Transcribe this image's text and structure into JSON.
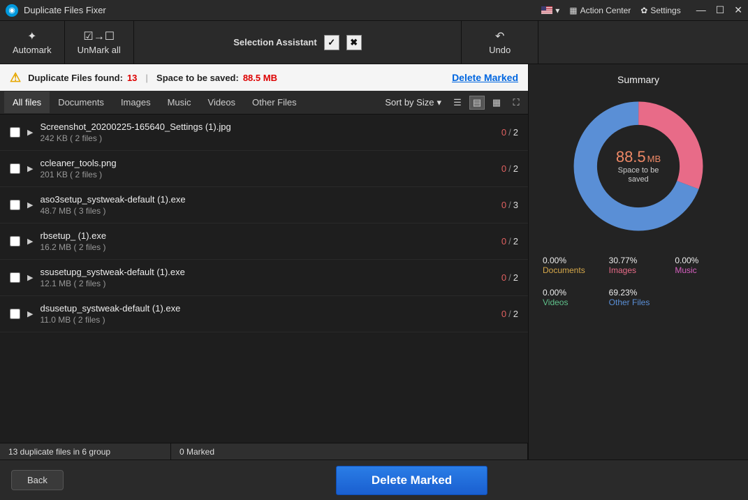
{
  "app": {
    "title": "Duplicate Files Fixer"
  },
  "titlebar": {
    "action_center": "Action Center",
    "settings": "Settings"
  },
  "toolbar": {
    "automark": "Automark",
    "unmark_all": "UnMark all",
    "selection_assistant": "Selection Assistant",
    "undo": "Undo"
  },
  "infobar": {
    "dup_label": "Duplicate Files found:",
    "dup_count": "13",
    "space_label": "Space to be saved:",
    "space_value": "88.5 MB",
    "delete_marked": "Delete Marked"
  },
  "tabs": {
    "all": "All files",
    "documents": "Documents",
    "images": "Images",
    "music": "Music",
    "videos": "Videos",
    "other": "Other Files",
    "sort_label": "Sort by Size"
  },
  "files": [
    {
      "name": "Screenshot_20200225-165640_Settings (1).jpg",
      "size": "242 KB",
      "count_label": "( 2 files )",
      "marked": "0",
      "total": "2"
    },
    {
      "name": "ccleaner_tools.png",
      "size": "201 KB",
      "count_label": "( 2 files )",
      "marked": "0",
      "total": "2"
    },
    {
      "name": "aso3setup_systweak-default (1).exe",
      "size": "48.7 MB",
      "count_label": "( 3 files )",
      "marked": "0",
      "total": "3"
    },
    {
      "name": "rbsetup_ (1).exe",
      "size": "16.2 MB",
      "count_label": "( 2 files )",
      "marked": "0",
      "total": "2"
    },
    {
      "name": "ssusetupg_systweak-default (1).exe",
      "size": "12.1 MB",
      "count_label": "( 2 files )",
      "marked": "0",
      "total": "2"
    },
    {
      "name": "dsusetup_systweak-default (1).exe",
      "size": "11.0 MB",
      "count_label": "( 2 files )",
      "marked": "0",
      "total": "2"
    }
  ],
  "status": {
    "groups": "13 duplicate files in 6 group",
    "marked": "0 Marked"
  },
  "bottom": {
    "back": "Back",
    "delete_marked": "Delete Marked"
  },
  "summary": {
    "title": "Summary",
    "value": "88.5",
    "unit": "MB",
    "label": "Space to be\nsaved",
    "legend": [
      {
        "pct": "0.00%",
        "cat": "Documents",
        "color": "#d6a84a"
      },
      {
        "pct": "30.77%",
        "cat": "Images",
        "color": "#e86b88"
      },
      {
        "pct": "0.00%",
        "cat": "Music",
        "color": "#d65fc0"
      },
      {
        "pct": "0.00%",
        "cat": "Videos",
        "color": "#5fc08a"
      },
      {
        "pct": "69.23%",
        "cat": "Other Files",
        "color": "#5a8fd6"
      }
    ]
  },
  "chart_data": {
    "type": "pie",
    "title": "Space to be saved",
    "unit": "MB",
    "total": 88.5,
    "series": [
      {
        "name": "Documents",
        "value": 0.0,
        "pct": 0.0,
        "color": "#d6a84a"
      },
      {
        "name": "Images",
        "value": 27.23,
        "pct": 30.77,
        "color": "#e86b88"
      },
      {
        "name": "Music",
        "value": 0.0,
        "pct": 0.0,
        "color": "#d65fc0"
      },
      {
        "name": "Videos",
        "value": 0.0,
        "pct": 0.0,
        "color": "#5fc08a"
      },
      {
        "name": "Other Files",
        "value": 61.27,
        "pct": 69.23,
        "color": "#5a8fd6"
      }
    ]
  }
}
